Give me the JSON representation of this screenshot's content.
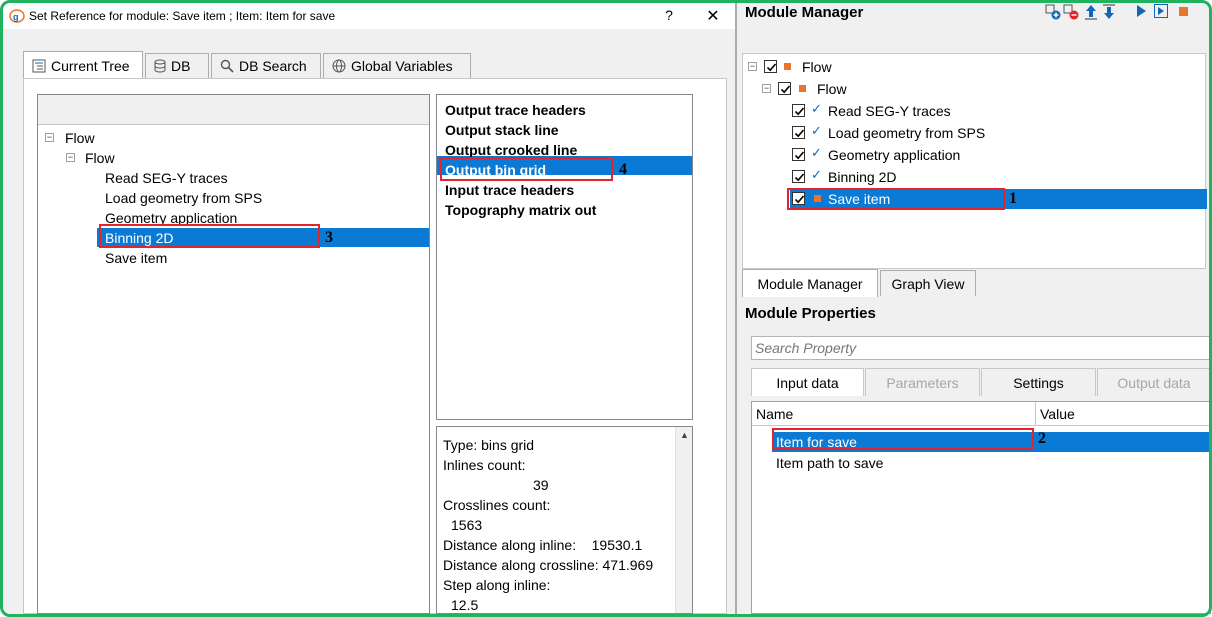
{
  "dialog": {
    "title": "Set Reference for module: Save item ; Item: Item for save",
    "help_glyph": "?",
    "close_glyph": "✕",
    "tabs": [
      {
        "label": "Current Tree",
        "icon": "tree-icon"
      },
      {
        "label": "DB",
        "icon": "database-icon"
      },
      {
        "label": "DB Search",
        "icon": "search-icon"
      },
      {
        "label": "Global Variables",
        "icon": "globe-icon"
      }
    ],
    "tree": {
      "root": "Flow",
      "child": "Flow",
      "items": [
        "Read SEG-Y traces",
        "Load geometry from SPS",
        "Geometry application",
        "Binning 2D",
        "Save item"
      ],
      "selected": "Binning 2D"
    },
    "outputs": {
      "items": [
        "Output trace headers",
        "Output stack line",
        "Output crooked line",
        "Output bin grid",
        "Input trace headers",
        "Topography matrix out"
      ],
      "selected": "Output bin grid"
    },
    "info": {
      "lines": [
        "Type: bins grid",
        "Inlines count:",
        "39",
        "Crosslines count:",
        "1563",
        "Distance along inline:    19530.1",
        "Distance along crossline: 471.969",
        "Step along inline:",
        "12.5"
      ]
    },
    "markers": {
      "m3": "3",
      "m4": "4"
    }
  },
  "module_manager": {
    "title": "Module Manager",
    "toolbar_icons": [
      "add-module-icon",
      "remove-module-icon",
      "move-up-icon",
      "move-down-icon",
      "run-icon",
      "run-step-icon",
      "stop-icon"
    ],
    "tree": {
      "root": "Flow",
      "child": "Flow",
      "items": [
        "Read SEG-Y traces",
        "Load geometry from SPS",
        "Geometry application",
        "Binning 2D",
        "Save item"
      ],
      "selected": "Save item"
    },
    "tabs": [
      "Module Manager",
      "Graph View"
    ],
    "marker": "1"
  },
  "module_properties": {
    "title": "Module Properties",
    "search_placeholder": "Search Property",
    "tabs": [
      {
        "label": "Input data",
        "state": "active"
      },
      {
        "label": "Parameters",
        "state": "disabled"
      },
      {
        "label": "Settings",
        "state": "normal"
      },
      {
        "label": "Output data",
        "state": "disabled"
      }
    ],
    "columns": [
      "Name",
      "Value"
    ],
    "rows": [
      "Item for save",
      "Item path to save"
    ],
    "selected": "Item for save",
    "marker": "2"
  },
  "colors": {
    "selection": "#0b7ad4",
    "highlight_box": "#e3252a",
    "module_square": "#e8742d",
    "frame": "#1fb360"
  }
}
